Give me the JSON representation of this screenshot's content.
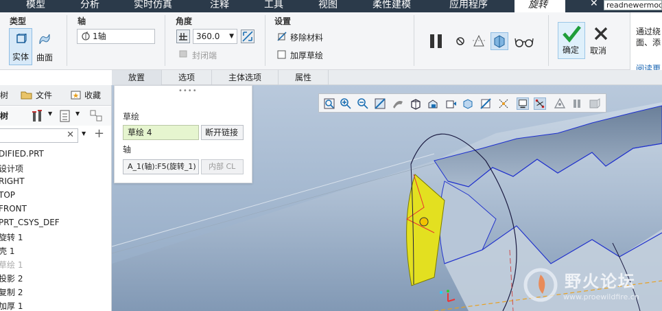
{
  "menubar": {
    "items": [
      "模型",
      "分析",
      "实时仿真",
      "注释",
      "工具",
      "视图",
      "柔性建模",
      "应用程序"
    ],
    "active_tab": "旋转",
    "search_value": "readnewermod"
  },
  "ribbon": {
    "type_group": {
      "title": "类型",
      "solid_label": "实体",
      "surface_label": "曲面"
    },
    "axis_group": {
      "title": "轴",
      "axis_value": "1轴"
    },
    "angle_group": {
      "title": "角度",
      "angle_value": "360.0",
      "cap_ends_label": "封闭端"
    },
    "settings_group": {
      "title": "设置",
      "remove_material_label": "移除材料",
      "thicken_sketch_label": "加厚草绘"
    },
    "confirm_label": "确定",
    "cancel_label": "取消"
  },
  "help_panel": {
    "line1": "通过绕",
    "line2": "面、添",
    "link": "阅读更"
  },
  "subtabs": [
    "放置",
    "选项",
    "主体选项",
    "属性"
  ],
  "left_panel": {
    "tabs": [
      "树",
      "文件",
      "收藏"
    ],
    "tree_title": "树",
    "items": [
      {
        "label": "DIFIED.PRT",
        "dim": false
      },
      {
        "label": "设计项",
        "dim": false
      },
      {
        "label": "RIGHT",
        "dim": false
      },
      {
        "label": "TOP",
        "dim": false
      },
      {
        "label": "FRONT",
        "dim": false
      },
      {
        "label": "PRT_CSYS_DEF",
        "dim": false
      },
      {
        "label": "旋转 1",
        "dim": false
      },
      {
        "label": "壳 1",
        "dim": false
      },
      {
        "label": "草绘 1",
        "dim": true
      },
      {
        "label": "投影 2",
        "dim": false
      },
      {
        "label": "复制 2",
        "dim": false
      },
      {
        "label": "加厚 1",
        "dim": false
      }
    ]
  },
  "placement_panel": {
    "sketch_label": "草绘",
    "sketch_value": "草绘 4",
    "break_link_label": "断开链接",
    "axis_label": "轴",
    "axis_value": "A_1(轴):F5(旋转_1)",
    "internal_label": "内部 CL"
  },
  "watermark": {
    "title": "野火论坛",
    "url": "www.proewildfire.cn"
  },
  "colors": {
    "menubar_bg": "#2b3a4a",
    "viewport_bg": "#a9bcd3",
    "sketch_highlight": "#e6f5cf",
    "section_fill": "#e3e020",
    "confirm_green": "#1f9e3a"
  }
}
